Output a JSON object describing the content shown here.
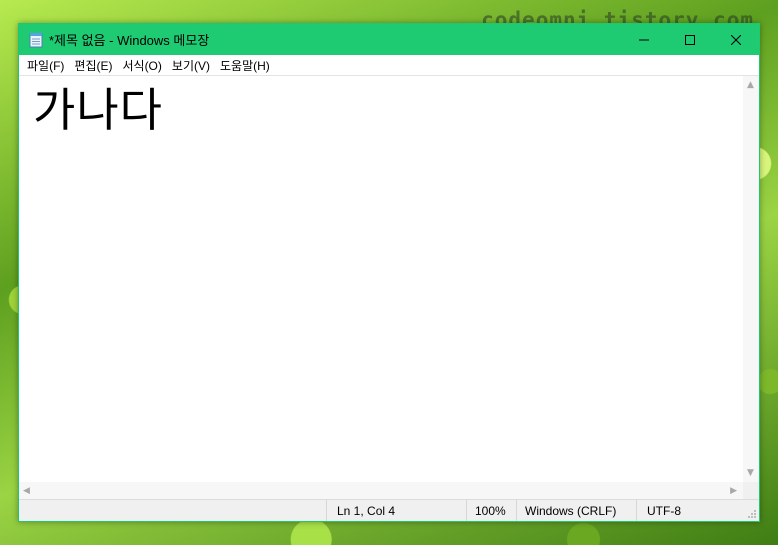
{
  "watermark": "codeomni.tistory.com",
  "window": {
    "title": "*제목 없음 - Windows 메모장",
    "icons": {
      "app": "notepad-icon",
      "minimize": "minimize-icon",
      "maximize": "maximize-icon",
      "close": "close-icon"
    },
    "colors": {
      "titlebar": "#1ecb73",
      "border": "#1ec86c"
    }
  },
  "menu": {
    "items": [
      {
        "label": "파일(F)"
      },
      {
        "label": "편집(E)"
      },
      {
        "label": "서식(O)"
      },
      {
        "label": "보기(V)"
      },
      {
        "label": "도움말(H)"
      }
    ]
  },
  "editor": {
    "content": "가나다"
  },
  "status": {
    "position": "Ln 1, Col 4",
    "zoom": "100%",
    "line_ending": "Windows (CRLF)",
    "encoding": "UTF-8"
  }
}
